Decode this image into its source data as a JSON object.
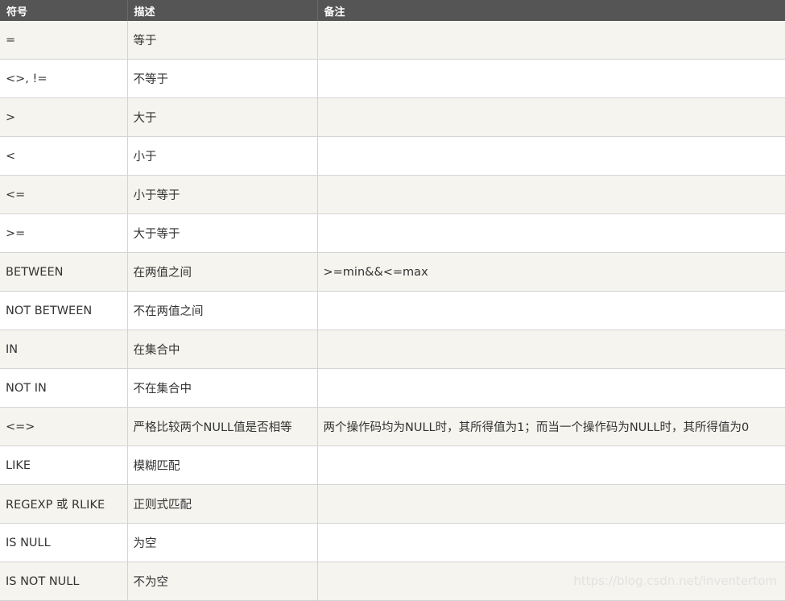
{
  "table": {
    "headers": [
      "符号",
      "描述",
      "备注"
    ],
    "rows": [
      [
        "=",
        "等于",
        ""
      ],
      [
        "<>, !=",
        "不等于",
        ""
      ],
      [
        ">",
        "大于",
        ""
      ],
      [
        "<",
        "小于",
        ""
      ],
      [
        "<=",
        "小于等于",
        ""
      ],
      [
        ">=",
        "大于等于",
        ""
      ],
      [
        "BETWEEN",
        "在两值之间",
        ">=min&&<=max"
      ],
      [
        "NOT BETWEEN",
        "不在两值之间",
        ""
      ],
      [
        "IN",
        "在集合中",
        ""
      ],
      [
        "NOT IN",
        "不在集合中",
        ""
      ],
      [
        "<=>",
        "严格比较两个NULL值是否相等",
        "两个操作码均为NULL时，其所得值为1；而当一个操作码为NULL时，其所得值为0"
      ],
      [
        "LIKE",
        "模糊匹配",
        ""
      ],
      [
        "REGEXP 或 RLIKE",
        "正则式匹配",
        ""
      ],
      [
        "IS NULL",
        "为空",
        ""
      ],
      [
        "IS NOT NULL",
        "不为空",
        ""
      ]
    ]
  },
  "watermark": "https://blog.csdn.net/inventertom"
}
